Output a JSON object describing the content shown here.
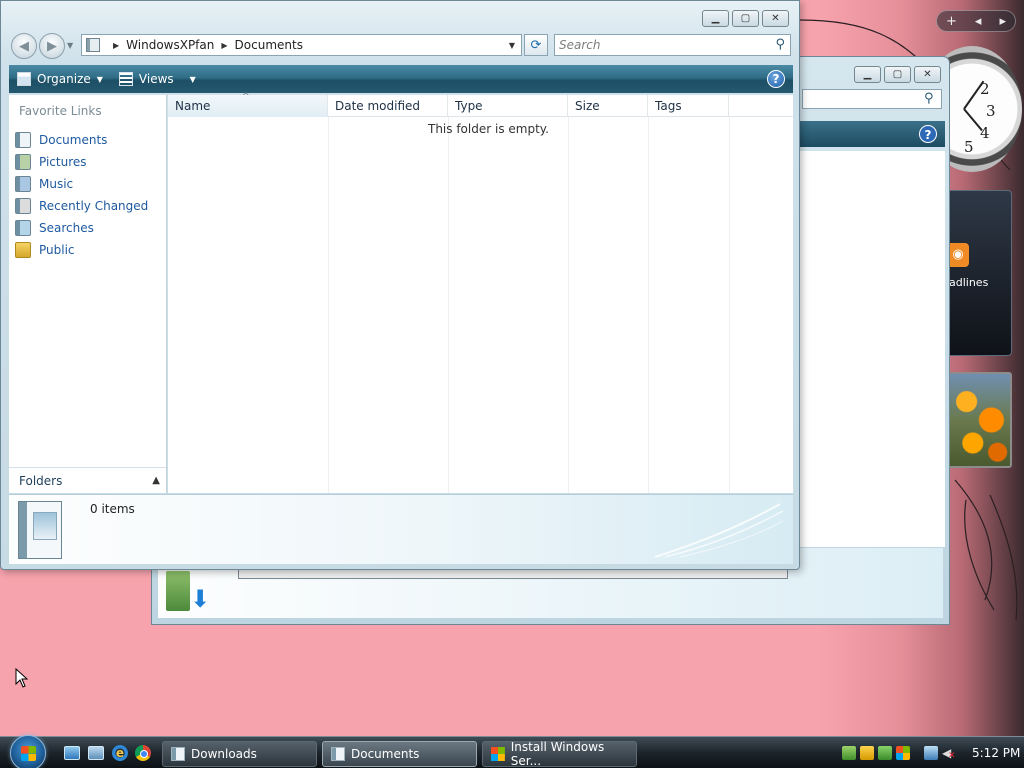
{
  "window": {
    "breadcrumb": [
      "WindowsXPfan",
      "Documents"
    ],
    "search_placeholder": "Search",
    "toolbar": {
      "organize": "Organize",
      "views": "Views"
    },
    "nav_pane": {
      "title": "Favorite Links",
      "items": [
        {
          "label": "Documents",
          "icon": "documents-folder-icon"
        },
        {
          "label": "Pictures",
          "icon": "pictures-folder-icon"
        },
        {
          "label": "Music",
          "icon": "music-folder-icon"
        },
        {
          "label": "Recently Changed",
          "icon": "recently-changed-icon"
        },
        {
          "label": "Searches",
          "icon": "searches-folder-icon"
        },
        {
          "label": "Public",
          "icon": "public-folder-icon"
        }
      ],
      "folders_label": "Folders"
    },
    "columns": [
      "Name",
      "Date modified",
      "Type",
      "Size",
      "Tags"
    ],
    "empty_message": "This folder is empty.",
    "details": {
      "item_count": "0 items"
    }
  },
  "background_window": {
    "gadget_rss_label": "adlines"
  },
  "taskbar": {
    "tasks": [
      {
        "label": "Downloads",
        "icon": "folder-icon"
      },
      {
        "label": "Documents",
        "icon": "folder-icon",
        "active": true
      },
      {
        "label": "Install Windows Ser...",
        "icon": "windows-icon"
      }
    ],
    "clock": "5:12 PM"
  },
  "colors": {
    "desktop": "#f7a3ad",
    "command_bar": "#2f6d87",
    "link": "#1e5aa0",
    "taskbar": "#1d252c"
  }
}
